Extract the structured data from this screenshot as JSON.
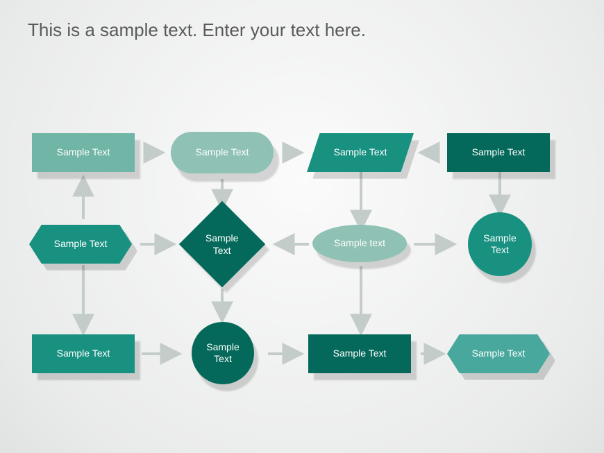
{
  "title": "This is a sample text. Enter your text here.",
  "nodes": {
    "r1c1": "Sample Text",
    "r1c2": "Sample Text",
    "r1c3": "Sample Text",
    "r1c4": "Sample Text",
    "r2c1": "Sample Text",
    "r2c2": "Sample Text",
    "r2c3": "Sample text",
    "r2c4": "Sample Text",
    "r3c1": "Sample Text",
    "r3c2": "Sample Text",
    "r3c3": "Sample Text",
    "r3c4": "Sample Text"
  },
  "colors": {
    "light": "#70b5a5",
    "pale": "#8fc1b5",
    "medium": "#189180",
    "dark": "#04695a",
    "midlight": "#49a89d",
    "arrow": "#bfc6c4"
  }
}
